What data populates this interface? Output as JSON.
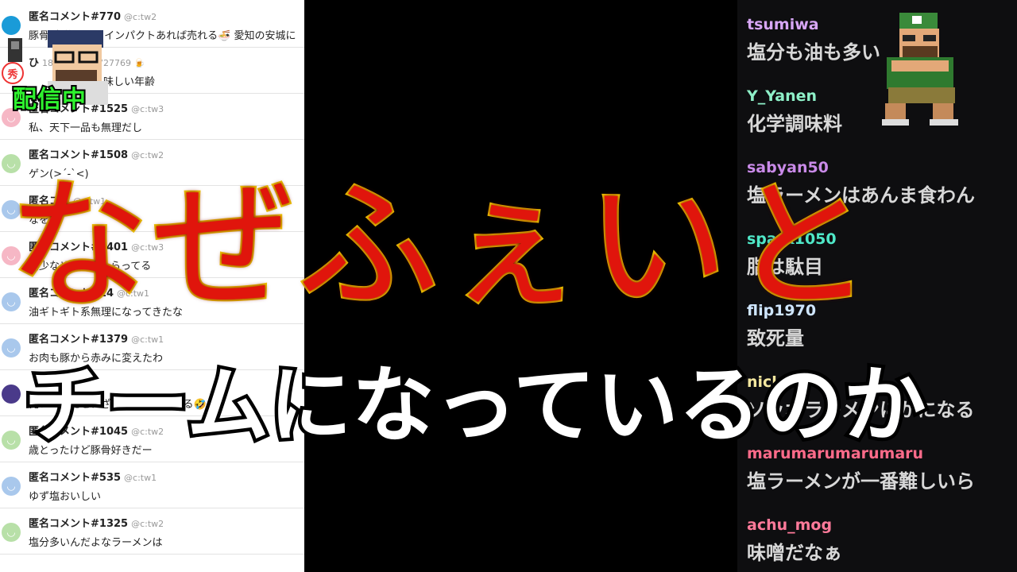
{
  "left_comments": [
    {
      "name": "匿名コメント#770",
      "handle": "@c:tw2",
      "text": "豚骨·大蒜くらいインパクトあれば売れる🍜 愛知の安城に",
      "avatar_color": "#1a9bd8",
      "avatar_glyph": ""
    },
    {
      "name": "ひ",
      "handle": "1830955498727769 🍺",
      "text": "",
      "avatar_color": "#ffffff",
      "avatar_glyph": "秀"
    },
    {
      "name": "匿名コメント#1525",
      "handle": "@c:tw3",
      "text": "私、天下一品も無理だし",
      "avatar_color": "#f6b7c5",
      "avatar_glyph": "◡"
    },
    {
      "name": "匿名コメント#1508",
      "handle": "@c:tw2",
      "text": "ゲン(>´-`<)",
      "avatar_color": "#b8e0a8",
      "avatar_glyph": "◡"
    },
    {
      "name": "匿名コメ",
      "handle": "@c:tw1",
      "text": "なを",
      "avatar_color": "#a9c8ec",
      "avatar_glyph": "◡"
    },
    {
      "name": "匿名コメント#1401",
      "handle": "@c:tw3",
      "text": "脂少なめにしてもらってる",
      "avatar_color": "#f6b7c5",
      "avatar_glyph": "◡"
    },
    {
      "name": "匿名コメント#14",
      "handle": "@c:tw1",
      "text": "油ギトギト系無理になってきたな",
      "avatar_color": "#a9c8ec",
      "avatar_glyph": "◡"
    },
    {
      "name": "匿名コメント#1379",
      "handle": "@c:tw1",
      "text": "お肉も豚から赤みに変えたわ",
      "avatar_color": "#a9c8ec",
      "avatar_glyph": "◡"
    },
    {
      "name": "",
      "handle": "",
      "text": "俺レベルだと、ざる蕎麦まで老いる🤣",
      "avatar_color": "#4a3a8a",
      "avatar_glyph": ""
    },
    {
      "name": "匿名コメント#1045",
      "handle": "@c:tw2",
      "text": "歳とったけど豚骨好きだー",
      "avatar_color": "#b8e0a8",
      "avatar_glyph": "◡"
    },
    {
      "name": "匿名コメント#535",
      "handle": "@c:tw1",
      "text": "ゆず塩おいしい",
      "avatar_color": "#a9c8ec",
      "avatar_glyph": "◡"
    },
    {
      "name": "匿名コメント#1325",
      "handle": "@c:tw2",
      "text": "塩分多いんだよなラーメンは",
      "avatar_color": "#b8e0a8",
      "avatar_glyph": "◡"
    }
  ],
  "second_row_text": "味しい年齢",
  "live_badge": "配信中",
  "chat_messages": [
    {
      "user": "tsumiwa",
      "color": "#d7a6f5",
      "text": "塩分も油も多い"
    },
    {
      "user": "Y_Yanen",
      "color": "#8ef0c8",
      "text": "化学調味料"
    },
    {
      "user": "sabyan50",
      "color": "#c98ae8",
      "text": "塩ラーメンはあんま食わん"
    },
    {
      "user": "spark1050",
      "color": "#4fe8c8",
      "text": "脂は駄目"
    },
    {
      "user": "flip1970",
      "color": "#cfe6ff",
      "text": "致死量"
    },
    {
      "user": "nickara",
      "color": "#f5e8a0",
      "text": "ソッポラーメンにがになる"
    },
    {
      "user": "marumarumarumaru",
      "color": "#ff6b8a",
      "text": "塩ラーメンが一番難しいら"
    },
    {
      "user": "achu_mog",
      "color": "#ff7a9a",
      "text": "味噌だなぁ"
    }
  ],
  "title_main": "なぜふぇいと",
  "title_sub": "チームになっているのか"
}
